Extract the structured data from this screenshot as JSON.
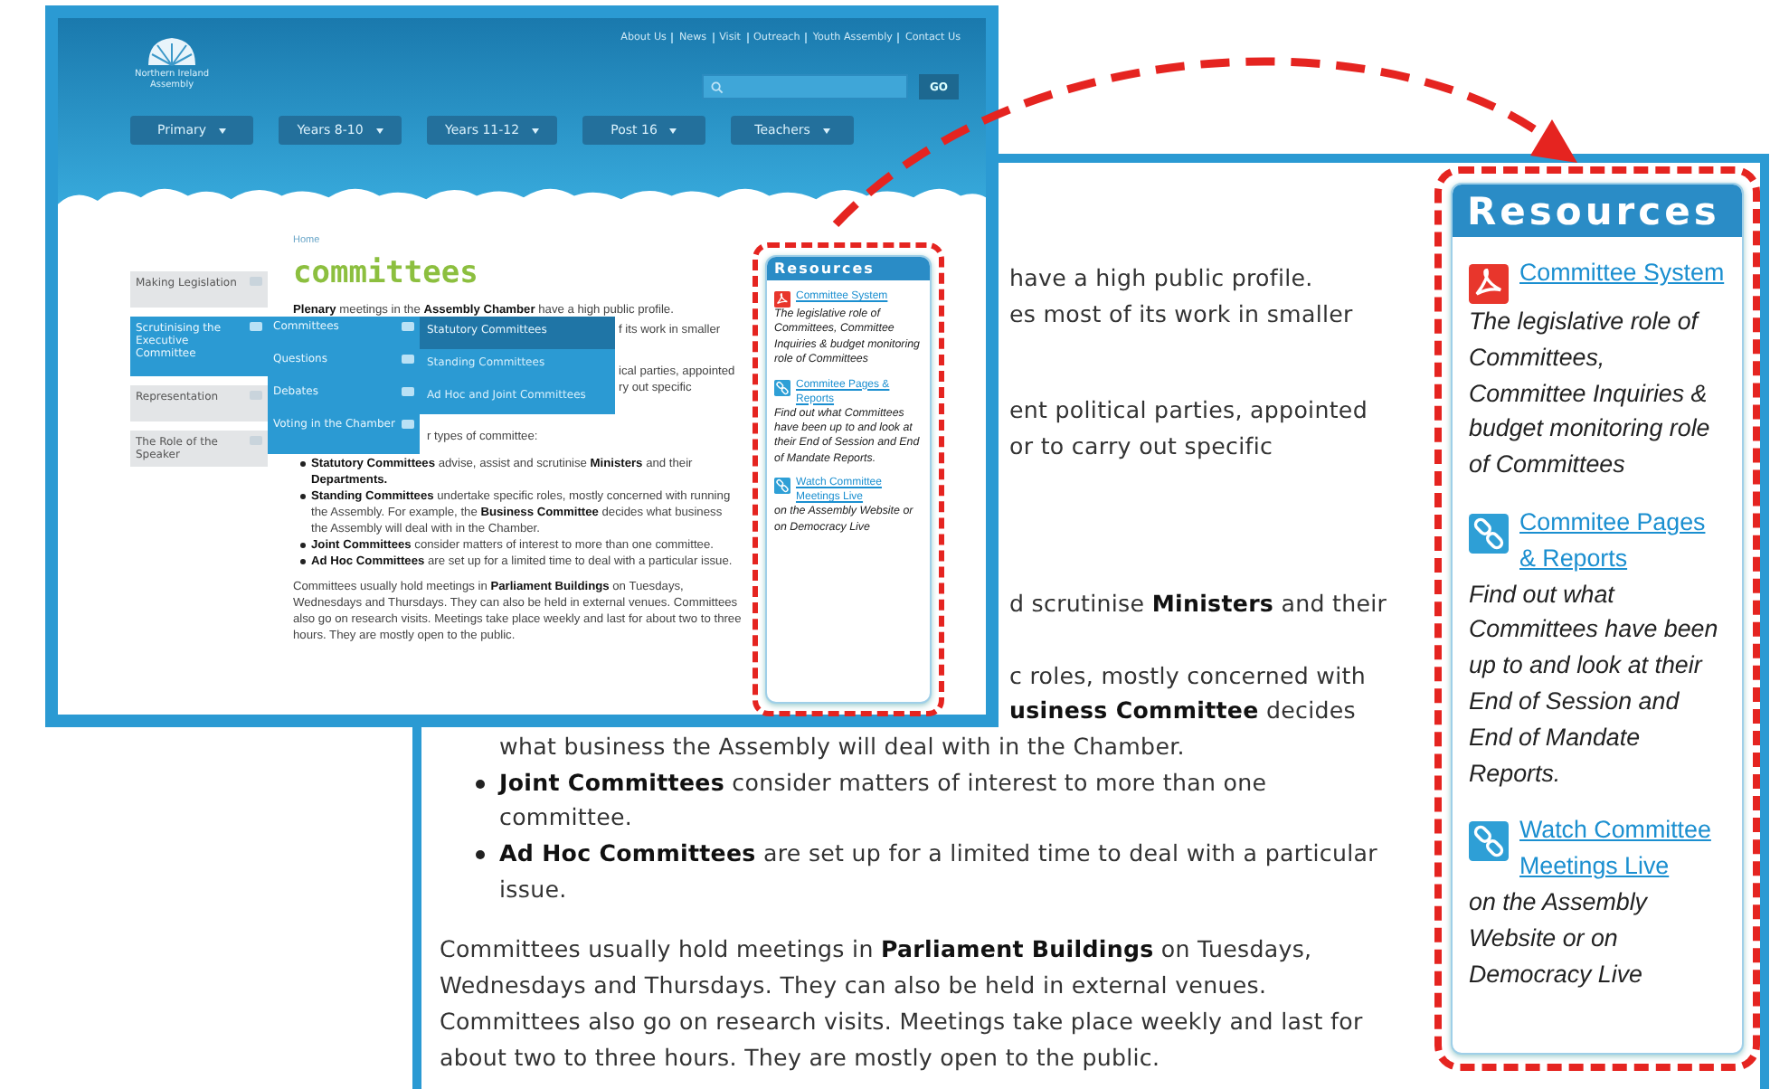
{
  "enlarged_page": {
    "article": [
      {
        "kind": "clipped",
        "text": "have a high public profile."
      },
      {
        "kind": "clipped",
        "text": "es most of its work in smaller"
      },
      {
        "kind": "clipped",
        "text": "ent political parties, appointed"
      },
      {
        "kind": "clipped",
        "text": "or to carry out specific"
      },
      {
        "kind": "clipped",
        "text": "d scrutinise **Ministers** and their"
      },
      {
        "kind": "clipped",
        "text": "c roles, mostly concerned with"
      },
      {
        "kind": "clipped",
        "text": "**usiness Committee** decides"
      },
      {
        "kind": "bullet_continued",
        "text": "what business the Assembly will deal with in the Chamber."
      },
      {
        "kind": "bullet",
        "text": "**Joint Committees** consider matters of interest to more than one committee."
      },
      {
        "kind": "bullet",
        "text": "**Ad Hoc Committees** are set up for a limited time to deal with a particular issue."
      },
      {
        "kind": "paragraph",
        "text": "Committees usually hold meetings in **Parliament Buildings** on Tuesdays, Wednesdays and Thursdays. They can also be held in external venues. Committees also go on research visits. Meetings take place weekly and last for about two to three hours. They are mostly open to the public."
      }
    ],
    "resources": {
      "title": "Resources",
      "items": [
        {
          "kind": "pdf",
          "link": "Committee System",
          "text": "The legislative role of Committees, Committee Inquiries & budget monitoring role of Committees"
        },
        {
          "kind": "link",
          "link": "Commitee Pages & Reports",
          "text": "Find out what Committees have been up to and look at their End of Session and End of Mandate Reports."
        },
        {
          "kind": "link",
          "link": "Watch Committee Meetings Live",
          "text": "on the Assembly Website or on Democracy Live"
        }
      ]
    }
  },
  "thumbnail_page": {
    "top_links": [
      "About Us",
      "News",
      "Visit",
      "Outreach",
      "Youth Assembly",
      "Contact Us"
    ],
    "logo": "Northern Ireland Assembly",
    "search": {
      "button": "GO"
    },
    "nav": [
      "Primary",
      "Years 8-10",
      "Years 11-12",
      "Post 16",
      "Teachers"
    ],
    "breadcrumb": "Home",
    "sidebar": [
      {
        "label": "Making Legislation",
        "selected": false
      },
      {
        "label": "Scrutinising the Executive Committee",
        "selected": true,
        "children": [
          {
            "label": "Committees",
            "children": [
              {
                "label": "Statutory Committees",
                "selected": true
              },
              {
                "label": "Standing Committees",
                "selected": false
              },
              {
                "label": "Ad Hoc and Joint Committees",
                "selected": false
              }
            ]
          },
          {
            "label": "Questions"
          },
          {
            "label": "Debates"
          },
          {
            "label": "Voting in the Chamber"
          }
        ]
      },
      {
        "label": "Representation",
        "selected": false
      },
      {
        "label": "The Role of the Speaker",
        "selected": false
      }
    ],
    "title": "committees",
    "article": [
      {
        "kind": "paragraph",
        "text": "**Plenary** meetings in the **Assembly Chamber** have a high public profile."
      },
      {
        "kind": "clipped_deep",
        "text": "f its work in smaller"
      },
      {
        "kind": "clipped_deep",
        "text": "ical parties, appointed"
      },
      {
        "kind": "clipped_deep",
        "text": "ry out specific"
      },
      {
        "kind": "clipped",
        "text": "r types of committee:"
      },
      {
        "kind": "bullet",
        "text": "**Statutory Committees** advise, assist and scrutinise **Ministers** and their **Departments.**"
      },
      {
        "kind": "bullet",
        "text": "**Standing Committees** undertake specific roles, mostly concerned with running the Assembly. For example, the **Business Committee** decides what business the Assembly will deal with in the Chamber."
      },
      {
        "kind": "bullet",
        "text": "**Joint Committees** consider matters of interest to more than one committee."
      },
      {
        "kind": "bullet",
        "text": "**Ad Hoc Committees** are set up for a limited time to deal with a particular issue."
      },
      {
        "kind": "paragraph",
        "text": "Committees usually hold meetings in **Parliament Buildings** on Tuesdays, Wednesdays and Thursdays. They can also be held in external venues. Committees also go on research visits. Meetings take place weekly and last for about two to three hours. They are mostly open to the public."
      }
    ],
    "resources": {
      "title": "Resources",
      "items": [
        {
          "kind": "pdf",
          "link": "Committee System",
          "text": "The legislative role of Committees, Committee Inquiries & budget monitoring role of Committees"
        },
        {
          "kind": "link",
          "link": "Commitee Pages & Reports",
          "text": "Find out what Committees have been up to and look at their End of Session and End of Mandate Reports."
        },
        {
          "kind": "link",
          "link": "Watch Committee Meetings Live",
          "text": "on the Assembly Website or on Democracy Live"
        }
      ]
    }
  }
}
